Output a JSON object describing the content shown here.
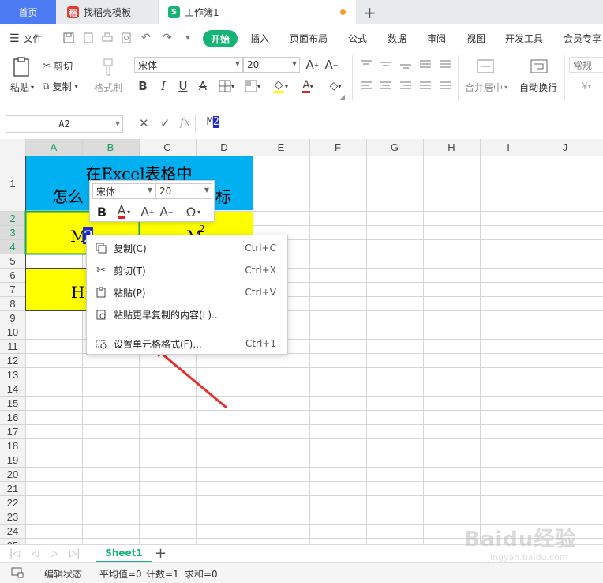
{
  "tabs": {
    "home": "首页",
    "template": "找稻壳模板",
    "workbook": "工作簿1"
  },
  "menu": {
    "file": "文件",
    "items": [
      "开始",
      "插入",
      "页面布局",
      "公式",
      "数据",
      "审阅",
      "视图",
      "开发工具",
      "会员专享"
    ]
  },
  "ribbon": {
    "paste": "粘贴",
    "cut": "剪切",
    "copy": "复制",
    "format_painter": "格式刷",
    "font_name": "宋体",
    "font_size": "20",
    "merge_center": "合并居中",
    "wrap_text": "自动换行",
    "number_format": "常规"
  },
  "formula_bar": {
    "name_box": "A2",
    "fx": "fx",
    "content_prefix": "M",
    "content_selected": "2"
  },
  "grid": {
    "columns": [
      "A",
      "B",
      "C",
      "D",
      "E",
      "F",
      "G",
      "H",
      "I",
      "J"
    ],
    "rows": [
      "1",
      "2",
      "3",
      "4",
      "5",
      "6",
      "7",
      "8",
      "9",
      "10",
      "11",
      "12",
      "13",
      "14",
      "15",
      "16",
      "17",
      "18",
      "19",
      "20",
      "21",
      "22",
      "23",
      "24",
      "25"
    ],
    "title_line1": "在Excel表格中",
    "title_line2_left": "怎么",
    "title_line2_right": "标",
    "a2_prefix": "M",
    "a2_selected": "2",
    "c2_base": "M",
    "c2_sup": "2",
    "a6_text": "H2"
  },
  "mini_toolbar": {
    "font": "宋体",
    "size": "20"
  },
  "context_menu": [
    {
      "label": "复制(C)",
      "shortcut": "Ctrl+C",
      "icon": "copy-icon"
    },
    {
      "label": "剪切(T)",
      "shortcut": "Ctrl+X",
      "icon": "scissors-icon"
    },
    {
      "label": "粘贴(P)",
      "shortcut": "Ctrl+V",
      "icon": "paste-icon"
    },
    {
      "label": "粘贴更早复制的内容(L)...",
      "shortcut": "",
      "icon": "paste-history-icon"
    },
    {
      "label": "设置单元格格式(F)...",
      "shortcut": "Ctrl+1",
      "icon": "format-cells-icon"
    }
  ],
  "sheet_tab": "Sheet1",
  "status": {
    "mode": "编辑状态",
    "average": "平均值=0",
    "count": "计数=1",
    "sum": "求和=0"
  },
  "watermark": {
    "brand": "Baidu经验",
    "url": "jingyan.baidu.com"
  },
  "colors": {
    "accent_green": "#15b374",
    "title_fill": "#00b0f0",
    "cell_fill": "#ffff00",
    "arrow": "#e8302a",
    "selection": "#1f2ad6"
  }
}
